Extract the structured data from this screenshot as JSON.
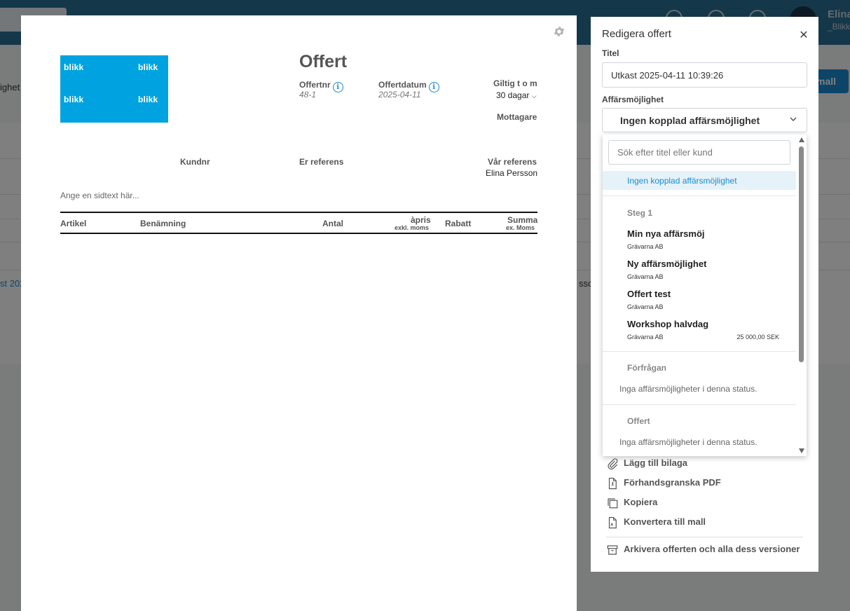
{
  "background": {
    "user_name": "Elina",
    "user_sub": "_Blikk",
    "left_fragment": "ighet",
    "button_fragment": "mall",
    "row_link_fragment": "st 202",
    "row_text_fragment": "sso"
  },
  "document": {
    "logo_word": "blikk",
    "title": "Offert",
    "offer_nr_label": "Offertnr",
    "offer_nr_value": "48-1",
    "offer_date_label": "Offertdatum",
    "offer_date_value": "2025-04-11",
    "valid_label": "Giltig t o m",
    "valid_value": "30 dagar",
    "recipient_label": "Mottagare",
    "customer_nr_label": "Kundnr",
    "your_ref_label": "Er referens",
    "our_ref_label": "Vår referens",
    "our_ref_value": "Elina Persson",
    "page_text_placeholder": "Ange en sidtext här...",
    "table_headers": {
      "article": "Artikel",
      "description": "Benämning",
      "quantity": "Antal",
      "price": "àpris",
      "price_sub": "exkl. moms",
      "discount": "Rabatt",
      "sum": "Summa",
      "sum_sub": "ex. Moms"
    }
  },
  "panel": {
    "title": "Redigera offert",
    "title_label": "Titel",
    "title_value": "Utkast 2025-04-11 10:39:26",
    "opportunity_label": "Affärsmöjlighet",
    "opportunity_value": "Ingen kopplad affärsmöjlighet",
    "dropdown": {
      "search_placeholder": "Sök efter titel eller kund",
      "selected_option": "Ingen kopplad affärsmöjlighet",
      "groups": [
        {
          "name": "Steg 1",
          "items": [
            {
              "title": "Min nya affärsmöj",
              "customer": "Grävarna AB",
              "amount": ""
            },
            {
              "title": "Ny affärsmöjlighet",
              "customer": "Grävarna AB",
              "amount": ""
            },
            {
              "title": "Offert test",
              "customer": "Grävarna AB",
              "amount": ""
            },
            {
              "title": "Workshop halvdag",
              "customer": "Grävarna AB",
              "amount": "25 000,00 SEK"
            }
          ]
        },
        {
          "name": "Förfrågan",
          "empty_text": "Inga affärsmöjligheter i denna status."
        },
        {
          "name": "Offert",
          "empty_text": "Inga affärsmöjligheter i denna status."
        }
      ]
    },
    "actions": [
      {
        "label": "Lägg till bilaga",
        "icon": "paperclip-icon"
      },
      {
        "label": "Förhandsgranska PDF",
        "icon": "pdf-file-icon"
      },
      {
        "label": "Kopiera",
        "icon": "copy-icon"
      },
      {
        "label": "Konvertera till mall",
        "icon": "template-file-icon"
      }
    ],
    "archive_label": "Arkivera offerten och alla dess versioner"
  }
}
